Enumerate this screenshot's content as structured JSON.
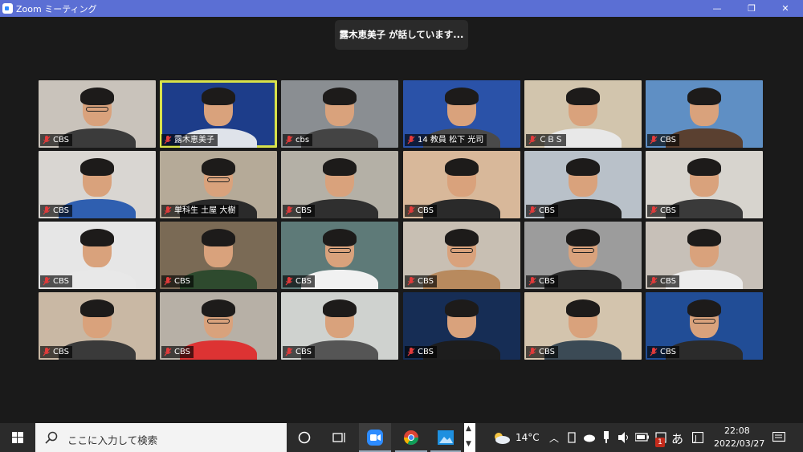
{
  "window": {
    "title": "Zoom ミーティング",
    "minimize": "—",
    "restore": "❐",
    "close": "✕"
  },
  "toast": {
    "text": "露木恵美子 が話しています..."
  },
  "participants": [
    {
      "name": "CBS",
      "bg": "#c9c3bb",
      "shirt": "#3b3b3b",
      "glasses": true
    },
    {
      "name": "露木恵美子",
      "bg": "#1d3d8a",
      "shirt": "#dfe3ea",
      "glasses": false,
      "active": true
    },
    {
      "name": "cbs",
      "bg": "#8a8e92",
      "shirt": "#444",
      "glasses": false
    },
    {
      "name": "14 教員 松下 光司",
      "bg": "#2a52a8",
      "shirt": "#4a4a4a",
      "glasses": false
    },
    {
      "name": "ＣＢＳ",
      "bg": "#d2c5ad",
      "shirt": "#e8e8e8",
      "glasses": false
    },
    {
      "name": "CBS",
      "bg": "#5f8fc4",
      "shirt": "#5a4030",
      "glasses": false
    },
    {
      "name": "CBS",
      "bg": "#d9d6d2",
      "shirt": "#2f5fb0",
      "glasses": false
    },
    {
      "name": "単科生  土屋 大樹",
      "bg": "#b5aa98",
      "shirt": "#2a2a2a",
      "glasses": true
    },
    {
      "name": "CBS",
      "bg": "#b4b0a6",
      "shirt": "#2f2f2f",
      "glasses": false
    },
    {
      "name": "CBS",
      "bg": "#d8b89a",
      "shirt": "#2a2a2a",
      "glasses": false
    },
    {
      "name": "CBS",
      "bg": "#b9c1c9",
      "shirt": "#222",
      "glasses": false
    },
    {
      "name": "CBS",
      "bg": "#d7d4ce",
      "shirt": "#3a3a3a",
      "glasses": false
    },
    {
      "name": "CBS",
      "bg": "#e6e6e6",
      "shirt": "#e8e8e8",
      "glasses": false
    },
    {
      "name": "CBS",
      "bg": "#7a6a55",
      "shirt": "#2e4a2e",
      "glasses": false
    },
    {
      "name": "CBS",
      "bg": "#5e7a78",
      "shirt": "#f1f1f1",
      "glasses": true
    },
    {
      "name": "CBS",
      "bg": "#c8bfb3",
      "shirt": "#b88a5e",
      "glasses": true
    },
    {
      "name": "CBS",
      "bg": "#9c9c9c",
      "shirt": "#2b2b2b",
      "glasses": true
    },
    {
      "name": "CBS",
      "bg": "#c7c0b8",
      "shirt": "#ececec",
      "glasses": false
    },
    {
      "name": "CBS",
      "bg": "#c9b8a4",
      "shirt": "#3a3a3a",
      "glasses": false
    },
    {
      "name": "CBS",
      "bg": "#b7b0a6",
      "shirt": "#d33",
      "glasses": true
    },
    {
      "name": "CBS",
      "bg": "#cfd2cf",
      "shirt": "#555",
      "glasses": false
    },
    {
      "name": "CBS",
      "bg": "#162d55",
      "shirt": "#1d1d1d",
      "glasses": false
    },
    {
      "name": "CBS",
      "bg": "#d3c4ad",
      "shirt": "#3b4a55",
      "glasses": false
    },
    {
      "name": "CBS",
      "bg": "#214d96",
      "shirt": "#2b2b2b",
      "glasses": true
    }
  ],
  "taskbar": {
    "search_placeholder": "ここに入力して検索",
    "weather_temp": "14°C",
    "ime": "あ",
    "time": "22:08",
    "date": "2022/03/27",
    "notif_count": "1"
  }
}
